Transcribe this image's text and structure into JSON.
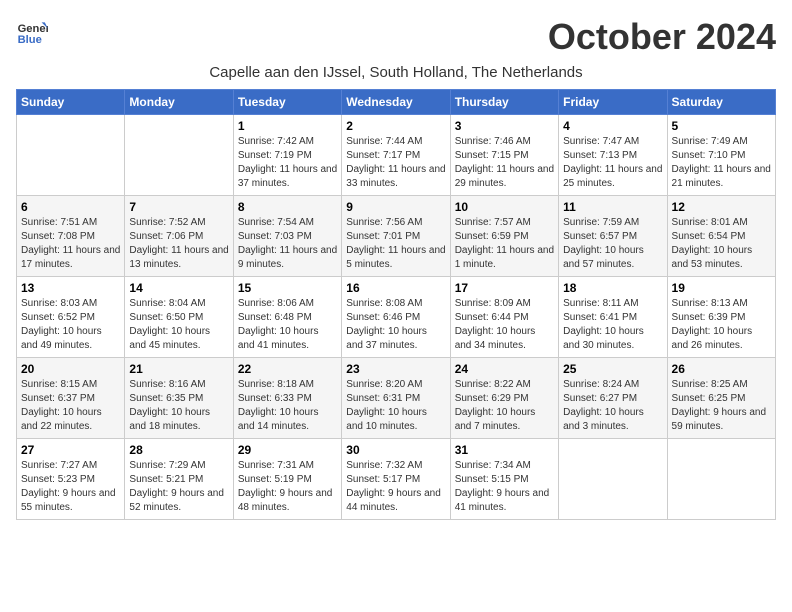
{
  "header": {
    "logo_line1": "General",
    "logo_line2": "Blue",
    "month_title": "October 2024",
    "subtitle": "Capelle aan den IJssel, South Holland, The Netherlands"
  },
  "days_of_week": [
    "Sunday",
    "Monday",
    "Tuesday",
    "Wednesday",
    "Thursday",
    "Friday",
    "Saturday"
  ],
  "weeks": [
    [
      {
        "num": "",
        "sunrise": "",
        "sunset": "",
        "daylight": ""
      },
      {
        "num": "",
        "sunrise": "",
        "sunset": "",
        "daylight": ""
      },
      {
        "num": "1",
        "sunrise": "Sunrise: 7:42 AM",
        "sunset": "Sunset: 7:19 PM",
        "daylight": "Daylight: 11 hours and 37 minutes."
      },
      {
        "num": "2",
        "sunrise": "Sunrise: 7:44 AM",
        "sunset": "Sunset: 7:17 PM",
        "daylight": "Daylight: 11 hours and 33 minutes."
      },
      {
        "num": "3",
        "sunrise": "Sunrise: 7:46 AM",
        "sunset": "Sunset: 7:15 PM",
        "daylight": "Daylight: 11 hours and 29 minutes."
      },
      {
        "num": "4",
        "sunrise": "Sunrise: 7:47 AM",
        "sunset": "Sunset: 7:13 PM",
        "daylight": "Daylight: 11 hours and 25 minutes."
      },
      {
        "num": "5",
        "sunrise": "Sunrise: 7:49 AM",
        "sunset": "Sunset: 7:10 PM",
        "daylight": "Daylight: 11 hours and 21 minutes."
      }
    ],
    [
      {
        "num": "6",
        "sunrise": "Sunrise: 7:51 AM",
        "sunset": "Sunset: 7:08 PM",
        "daylight": "Daylight: 11 hours and 17 minutes."
      },
      {
        "num": "7",
        "sunrise": "Sunrise: 7:52 AM",
        "sunset": "Sunset: 7:06 PM",
        "daylight": "Daylight: 11 hours and 13 minutes."
      },
      {
        "num": "8",
        "sunrise": "Sunrise: 7:54 AM",
        "sunset": "Sunset: 7:03 PM",
        "daylight": "Daylight: 11 hours and 9 minutes."
      },
      {
        "num": "9",
        "sunrise": "Sunrise: 7:56 AM",
        "sunset": "Sunset: 7:01 PM",
        "daylight": "Daylight: 11 hours and 5 minutes."
      },
      {
        "num": "10",
        "sunrise": "Sunrise: 7:57 AM",
        "sunset": "Sunset: 6:59 PM",
        "daylight": "Daylight: 11 hours and 1 minute."
      },
      {
        "num": "11",
        "sunrise": "Sunrise: 7:59 AM",
        "sunset": "Sunset: 6:57 PM",
        "daylight": "Daylight: 10 hours and 57 minutes."
      },
      {
        "num": "12",
        "sunrise": "Sunrise: 8:01 AM",
        "sunset": "Sunset: 6:54 PM",
        "daylight": "Daylight: 10 hours and 53 minutes."
      }
    ],
    [
      {
        "num": "13",
        "sunrise": "Sunrise: 8:03 AM",
        "sunset": "Sunset: 6:52 PM",
        "daylight": "Daylight: 10 hours and 49 minutes."
      },
      {
        "num": "14",
        "sunrise": "Sunrise: 8:04 AM",
        "sunset": "Sunset: 6:50 PM",
        "daylight": "Daylight: 10 hours and 45 minutes."
      },
      {
        "num": "15",
        "sunrise": "Sunrise: 8:06 AM",
        "sunset": "Sunset: 6:48 PM",
        "daylight": "Daylight: 10 hours and 41 minutes."
      },
      {
        "num": "16",
        "sunrise": "Sunrise: 8:08 AM",
        "sunset": "Sunset: 6:46 PM",
        "daylight": "Daylight: 10 hours and 37 minutes."
      },
      {
        "num": "17",
        "sunrise": "Sunrise: 8:09 AM",
        "sunset": "Sunset: 6:44 PM",
        "daylight": "Daylight: 10 hours and 34 minutes."
      },
      {
        "num": "18",
        "sunrise": "Sunrise: 8:11 AM",
        "sunset": "Sunset: 6:41 PM",
        "daylight": "Daylight: 10 hours and 30 minutes."
      },
      {
        "num": "19",
        "sunrise": "Sunrise: 8:13 AM",
        "sunset": "Sunset: 6:39 PM",
        "daylight": "Daylight: 10 hours and 26 minutes."
      }
    ],
    [
      {
        "num": "20",
        "sunrise": "Sunrise: 8:15 AM",
        "sunset": "Sunset: 6:37 PM",
        "daylight": "Daylight: 10 hours and 22 minutes."
      },
      {
        "num": "21",
        "sunrise": "Sunrise: 8:16 AM",
        "sunset": "Sunset: 6:35 PM",
        "daylight": "Daylight: 10 hours and 18 minutes."
      },
      {
        "num": "22",
        "sunrise": "Sunrise: 8:18 AM",
        "sunset": "Sunset: 6:33 PM",
        "daylight": "Daylight: 10 hours and 14 minutes."
      },
      {
        "num": "23",
        "sunrise": "Sunrise: 8:20 AM",
        "sunset": "Sunset: 6:31 PM",
        "daylight": "Daylight: 10 hours and 10 minutes."
      },
      {
        "num": "24",
        "sunrise": "Sunrise: 8:22 AM",
        "sunset": "Sunset: 6:29 PM",
        "daylight": "Daylight: 10 hours and 7 minutes."
      },
      {
        "num": "25",
        "sunrise": "Sunrise: 8:24 AM",
        "sunset": "Sunset: 6:27 PM",
        "daylight": "Daylight: 10 hours and 3 minutes."
      },
      {
        "num": "26",
        "sunrise": "Sunrise: 8:25 AM",
        "sunset": "Sunset: 6:25 PM",
        "daylight": "Daylight: 9 hours and 59 minutes."
      }
    ],
    [
      {
        "num": "27",
        "sunrise": "Sunrise: 7:27 AM",
        "sunset": "Sunset: 5:23 PM",
        "daylight": "Daylight: 9 hours and 55 minutes."
      },
      {
        "num": "28",
        "sunrise": "Sunrise: 7:29 AM",
        "sunset": "Sunset: 5:21 PM",
        "daylight": "Daylight: 9 hours and 52 minutes."
      },
      {
        "num": "29",
        "sunrise": "Sunrise: 7:31 AM",
        "sunset": "Sunset: 5:19 PM",
        "daylight": "Daylight: 9 hours and 48 minutes."
      },
      {
        "num": "30",
        "sunrise": "Sunrise: 7:32 AM",
        "sunset": "Sunset: 5:17 PM",
        "daylight": "Daylight: 9 hours and 44 minutes."
      },
      {
        "num": "31",
        "sunrise": "Sunrise: 7:34 AM",
        "sunset": "Sunset: 5:15 PM",
        "daylight": "Daylight: 9 hours and 41 minutes."
      },
      {
        "num": "",
        "sunrise": "",
        "sunset": "",
        "daylight": ""
      },
      {
        "num": "",
        "sunrise": "",
        "sunset": "",
        "daylight": ""
      }
    ]
  ]
}
